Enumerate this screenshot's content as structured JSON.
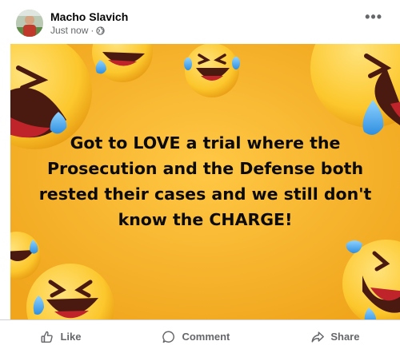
{
  "post": {
    "author": "Macho Slavich",
    "timestamp": "Just now",
    "separator": "·",
    "privacy_icon": "globe-icon",
    "more_icon": "more-options-icon",
    "more_label": "•••",
    "caption_lines": [
      "Got to LOVE a trial where the",
      "Prosecution and the Defense both",
      "rested their cases and we still don't",
      "know the CHARGE!"
    ]
  },
  "actions": {
    "like": {
      "label": "Like",
      "icon": "thumbs-up-icon"
    },
    "comment": {
      "label": "Comment",
      "icon": "comment-bubble-icon"
    },
    "share": {
      "label": "Share",
      "icon": "share-arrow-icon"
    }
  },
  "colors": {
    "background_yellow": "#f6b52a",
    "emoji_yellow": "#fcc72c",
    "tear_blue": "#3fa9f5",
    "mouth_red": "#c0242b",
    "meta_gray": "#65676b"
  }
}
